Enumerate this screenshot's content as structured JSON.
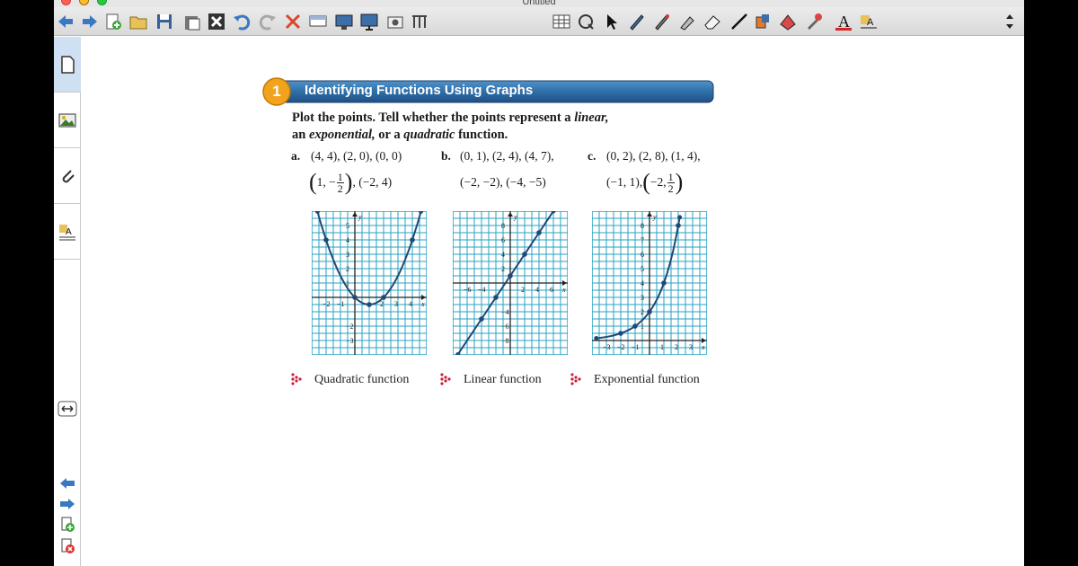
{
  "window": {
    "title": "Untitled"
  },
  "toolbar": {
    "items": [
      "back-icon",
      "forward-icon",
      "add-page-icon",
      "open-folder-icon",
      "save-icon",
      "paste-icon",
      "delete-icon",
      "undo-icon",
      "redo-icon",
      "clear-icon",
      "screen-shade-icon",
      "display-icon",
      "presentation-icon",
      "capture-icon",
      "window-capture-icon",
      "table-icon",
      "properties-icon",
      "select-icon",
      "pen-icon",
      "creative-pen-icon",
      "highlighter-icon",
      "eraser-icon",
      "line-icon",
      "fill-icon",
      "shape-icon",
      "magic-pen-icon",
      "text-icon",
      "text-format-icon",
      "toolbar-toggle-icon"
    ]
  },
  "sidebar": {
    "tabs": [
      "page-sorter",
      "gallery",
      "attachments",
      "properties"
    ]
  },
  "lesson": {
    "badge_number": "1",
    "heading": "Identifying Functions Using Graphs",
    "prompt_line1_start": "Plot the points. Tell whether the points represent a ",
    "prompt_line1_em": "linear,",
    "prompt_line2_start": "an ",
    "prompt_line2_em1": "exponential,",
    "prompt_line2_mid": " or a ",
    "prompt_line2_em2": "quadratic",
    "prompt_line2_end": " function.",
    "problems": [
      {
        "label": "a.",
        "line1": "(4, 4), (2, 0), (0, 0)",
        "line2_pre": "1, −",
        "frac_num": "1",
        "frac_den": "2",
        "line2_post": ", (−2, 4)",
        "answer": "Quadratic function"
      },
      {
        "label": "b.",
        "line1": "(0, 1), (2, 4), (4, 7),",
        "line2": "(−2, −2), (−4, −5)",
        "answer": "Linear function"
      },
      {
        "label": "c.",
        "line1": "(0, 2), (2, 8), (1, 4),",
        "line2_pre": "(−1, 1), ",
        "line2_mid": "−2, ",
        "frac_num": "1",
        "frac_den": "2",
        "answer": "Exponential function"
      }
    ]
  },
  "graphs": [
    {
      "name": "quadratic",
      "type": "parabola",
      "xlabel": "x",
      "ylabel": "y",
      "x_ticks": [
        "−2",
        "−1",
        "2",
        "3",
        "4"
      ],
      "y_ticks": [
        "5",
        "4",
        "3",
        "2",
        "1",
        "−2",
        "−3"
      ],
      "points": [
        [
          4,
          4
        ],
        [
          2,
          0
        ],
        [
          0,
          0
        ],
        [
          1,
          -0.5
        ],
        [
          -2,
          4
        ]
      ]
    },
    {
      "name": "linear",
      "type": "line",
      "xlabel": "x",
      "ylabel": "y",
      "x_ticks": [
        "−6",
        "−4",
        "2",
        "4",
        "6"
      ],
      "y_ticks": [
        "8",
        "6",
        "4",
        "2",
        "−4",
        "−6",
        "−8"
      ],
      "points": [
        [
          0,
          1
        ],
        [
          2,
          4
        ],
        [
          4,
          7
        ],
        [
          -2,
          -2
        ],
        [
          -4,
          -5
        ]
      ]
    },
    {
      "name": "exponential",
      "type": "exponential",
      "xlabel": "x",
      "ylabel": "y",
      "x_ticks": [
        "−3",
        "−2",
        "−1",
        "1",
        "2",
        "3"
      ],
      "y_ticks": [
        "8",
        "7",
        "6",
        "5",
        "4",
        "3",
        "2",
        "1"
      ],
      "points": [
        [
          0,
          2
        ],
        [
          2,
          8
        ],
        [
          1,
          4
        ],
        [
          -1,
          1
        ],
        [
          -2,
          0.5
        ]
      ]
    }
  ],
  "colors": {
    "accent": "#2f6fa8",
    "grid": "#27a3c3",
    "curve": "#1f4a78",
    "badge": "#f2a31d"
  }
}
